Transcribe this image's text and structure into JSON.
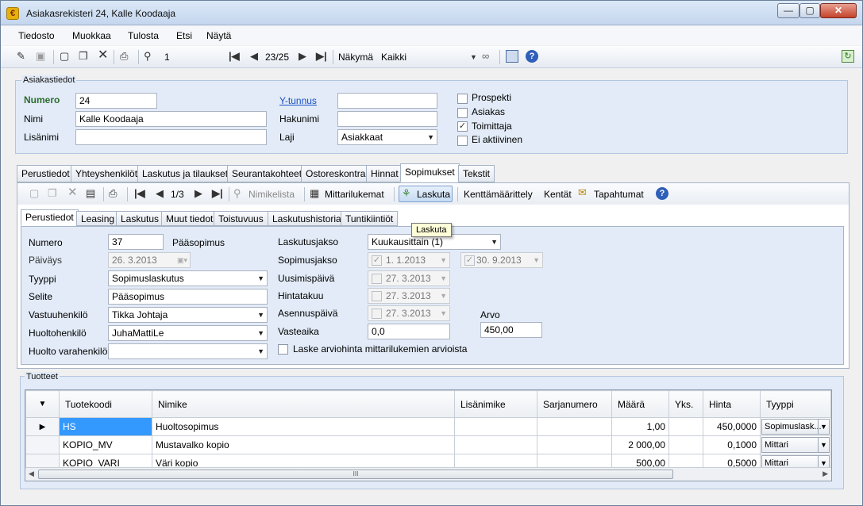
{
  "window": {
    "title": "Asiakasrekisteri 24, Kalle Koodaaja",
    "min": "—",
    "max": "▢",
    "close": "✕"
  },
  "menu": [
    "Tiedosto",
    "Muokkaa",
    "Tulosta",
    "Etsi",
    "Näytä"
  ],
  "toolbar": {
    "search_value": "1",
    "record_pos": "23/25",
    "view_label": "Näkymä",
    "view_value": "Kaikki"
  },
  "customer": {
    "group_title": "Asiakastiedot",
    "numero_label": "Numero",
    "numero_value": "24",
    "nimi_label": "Nimi",
    "nimi_value": "Kalle Koodaaja",
    "lisanimi_label": "Lisänimi",
    "lisanimi_value": "",
    "ytunnus_label": "Y-tunnus",
    "ytunnus_value": "",
    "hakunimi_label": "Hakunimi",
    "hakunimi_value": "",
    "laji_label": "Laji",
    "laji_value": "Asiakkaat",
    "checks": [
      {
        "label": "Prospekti",
        "checked": false
      },
      {
        "label": "Asiakas",
        "checked": false
      },
      {
        "label": "Toimittaja",
        "checked": true
      },
      {
        "label": "Ei aktiivinen",
        "checked": false
      }
    ]
  },
  "tabs": [
    "Perustiedot",
    "Yhteyshenkilöt",
    "Laskutus ja tilaukset",
    "Seurantakohteet",
    "Ostoreskontra",
    "Hinnat",
    "Sopimukset",
    "Tekstit"
  ],
  "contract_toolbar": {
    "record_pos": "1/3",
    "nimikelista": "Nimikelista",
    "mittarilukemat": "Mittarilukemat",
    "laskuta": "Laskuta",
    "kenttamaarittely": "Kenttämäärittely",
    "kentat": "Kentät",
    "tapahtumat": "Tapahtumat"
  },
  "tooltip": "Laskuta",
  "subtabs": [
    "Perustiedot",
    "Leasing",
    "Laskutus",
    "Muut tiedot",
    "Toistuvuus",
    "Laskutushistoria",
    "Tuntikiintiöt"
  ],
  "contract": {
    "numero_label": "Numero",
    "numero_value": "37",
    "paasopimus": "Pääsopimus",
    "paivays_label": "Päiväys",
    "paivays_value": "26. 3.2013",
    "tyyppi_label": "Tyyppi",
    "tyyppi_value": "Sopimuslaskutus",
    "selite_label": "Selite",
    "selite_value": "Pääsopimus",
    "vastuuhenkilo_label": "Vastuuhenkilö",
    "vastuuhenkilo_value": "Tikka Johtaja",
    "huoltohenkilo_label": "Huoltohenkilö",
    "huoltohenkilo_value": "JuhaMattiLe",
    "huoltovara_label": "Huolto varahenkilö",
    "huoltovara_value": "",
    "laskutusjakso_label": "Laskutusjakso",
    "laskutusjakso_value": "Kuukausittain (1)",
    "sopimusjakso_label": "Sopimusjakso",
    "sopimusjakso_start": "1. 1.2013",
    "sopimusjakso_end": "30. 9.2013",
    "uusimispaiva_label": "Uusimispäivä",
    "uusimispaiva_value": "27. 3.2013",
    "hintatakuu_label": "Hintatakuu",
    "hintatakuu_value": "27. 3.2013",
    "asennuspaiva_label": "Asennuspäivä",
    "asennuspaiva_value": "27. 3.2013",
    "arvo_label": "Arvo",
    "arvo_value": "450,00",
    "vasteaika_label": "Vasteaika",
    "vasteaika_value": "0,0",
    "laske_label": "Laske arviohinta mittarilukemien arvioista"
  },
  "products": {
    "group_title": "Tuotteet",
    "columns": [
      "Tuotekoodi",
      "Nimike",
      "Lisänimike",
      "Sarjanumero",
      "Määrä",
      "Yks.",
      "Hinta",
      "Tyyppi"
    ],
    "rows": [
      {
        "code": "HS",
        "name": "Huoltosopimus",
        "extra": "",
        "serial": "",
        "qty": "1,00",
        "unit": "",
        "price": "450,0000",
        "type": "Sopimuslask..."
      },
      {
        "code": "KOPIO_MV",
        "name": "Mustavalko kopio",
        "extra": "",
        "serial": "",
        "qty": "2 000,00",
        "unit": "",
        "price": "0,1000",
        "type": "Mittari"
      },
      {
        "code": "KOPIO_VARI",
        "name": "Väri kopio",
        "extra": "",
        "serial": "",
        "qty": "500,00",
        "unit": "",
        "price": "0,5000",
        "type": "Mittari"
      }
    ],
    "scroll_thumb": "III"
  }
}
